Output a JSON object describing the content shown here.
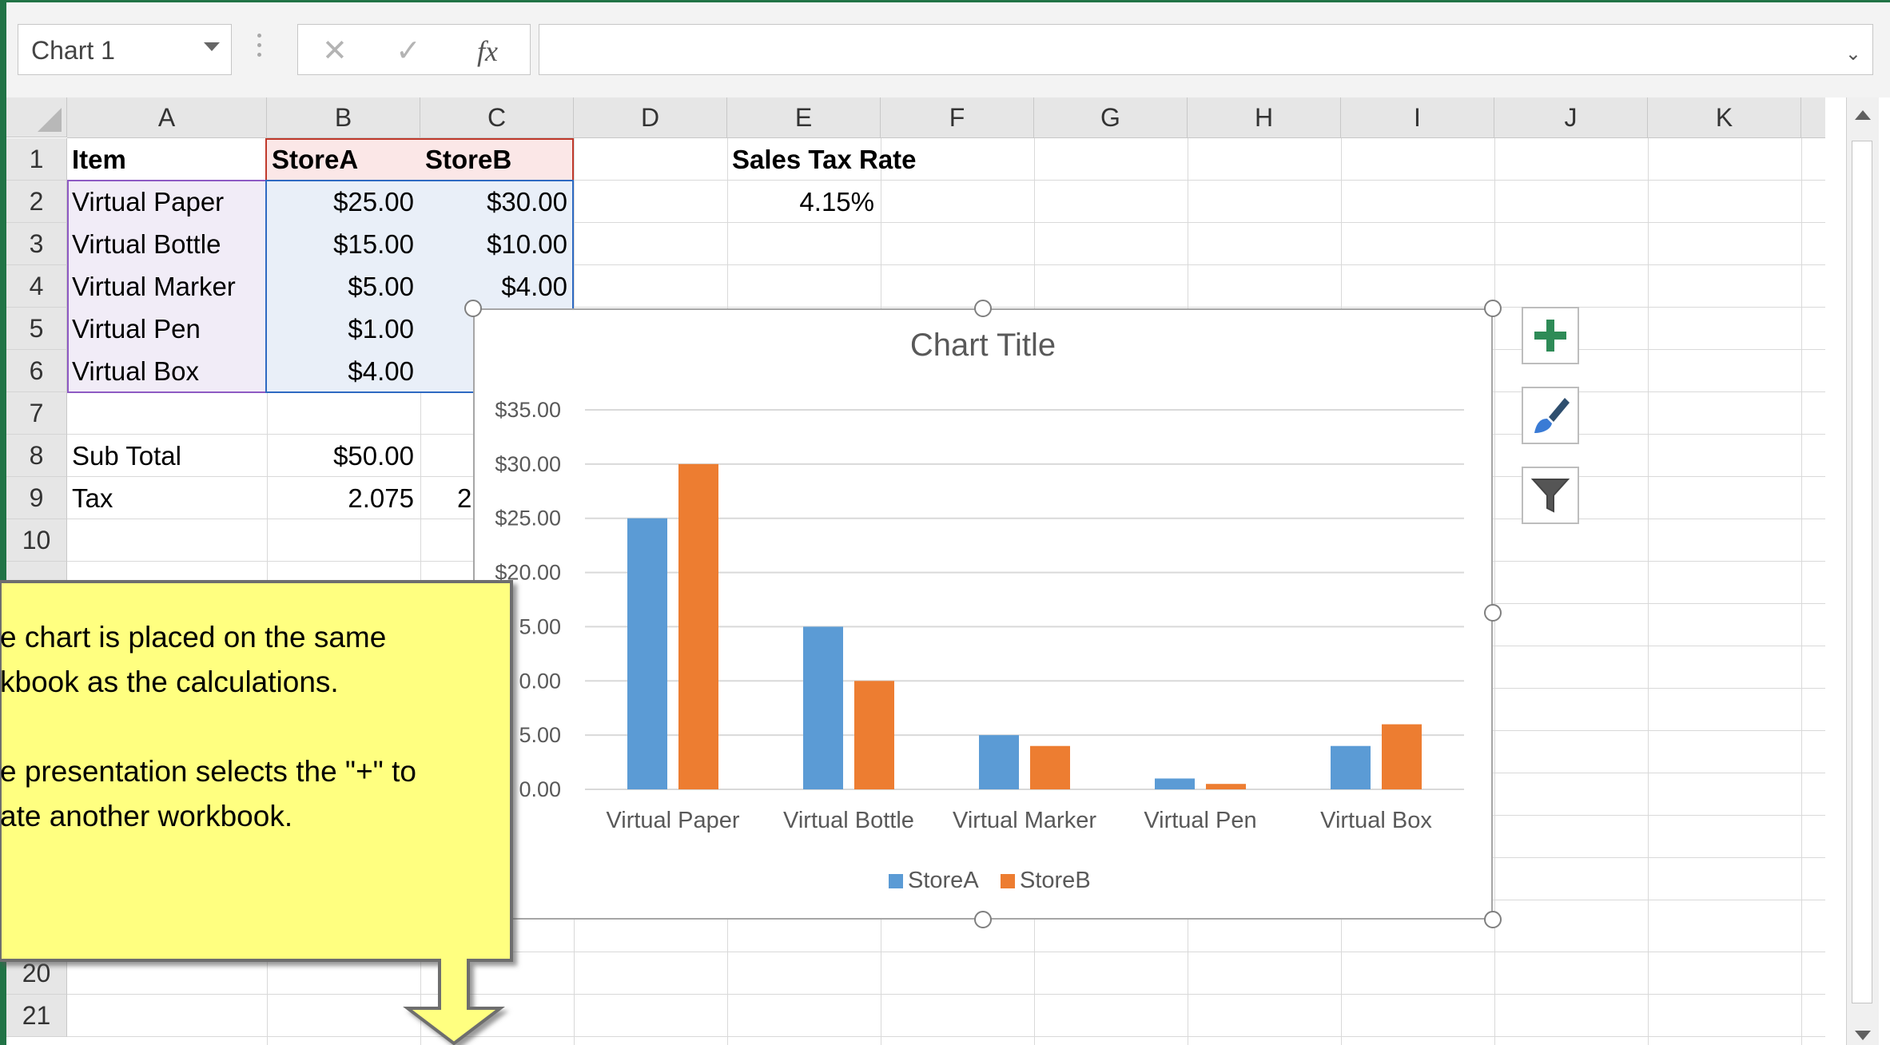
{
  "name_box": {
    "value": "Chart 1"
  },
  "formula_bar": {
    "cancel_icon": "close-icon",
    "enter_icon": "check-icon",
    "function_label": "fx",
    "value": ""
  },
  "columns": [
    "A",
    "B",
    "C",
    "D",
    "E",
    "F",
    "G",
    "H",
    "I",
    "J",
    "K"
  ],
  "rows": [
    "1",
    "2",
    "3",
    "4",
    "5",
    "6",
    "7",
    "8",
    "9",
    "10",
    "20",
    "21"
  ],
  "cells": {
    "A1": "Item",
    "B1": "StoreA",
    "C1": "StoreB",
    "E1": "Sales Tax Rate",
    "A2": "Virtual Paper",
    "B2": "$25.00",
    "C2": "$30.00",
    "E2": "4.15%",
    "A3": "Virtual Bottle",
    "B3": "$15.00",
    "C3": "$10.00",
    "A4": "Virtual Marker",
    "B4": "$5.00",
    "C4": "$4.00",
    "A5": "Virtual Pen",
    "B5": "$1.00",
    "A6": "Virtual Box",
    "B6": "$4.00",
    "A8": "Sub Total",
    "B8": "$50.00",
    "A9": "Tax",
    "B9": "2.075",
    "C9": "2"
  },
  "chart_side_buttons": [
    {
      "name": "chart-elements-button",
      "icon": "plus-icon"
    },
    {
      "name": "chart-styles-button",
      "icon": "brush-icon"
    },
    {
      "name": "chart-filters-button",
      "icon": "filter-icon"
    }
  ],
  "callout": {
    "line1": "e chart is placed on the same",
    "line2": "kbook as the calculations.",
    "line3": "e presentation selects the \"+\" to",
    "line4": "ate another workbook.",
    "background": "#ffff80",
    "arrow_color": "#ffff80"
  },
  "chart_data": {
    "type": "bar",
    "title": "Chart Title",
    "categories": [
      "Virtual Paper",
      "Virtual Bottle",
      "Virtual Marker",
      "Virtual Pen",
      "Virtual Box"
    ],
    "series": [
      {
        "name": "StoreA",
        "values": [
          25,
          15,
          5,
          1,
          4
        ],
        "color": "#5b9bd5"
      },
      {
        "name": "StoreB",
        "values": [
          30,
          10,
          4,
          0.5,
          6
        ],
        "color": "#ed7d31"
      }
    ],
    "y_ticks": [
      "$35.00",
      "$30.00",
      "$25.00",
      "$20.00",
      "5.00",
      "0.00",
      "5.00",
      "0.00"
    ],
    "ylim": [
      0,
      35
    ],
    "grid": true,
    "legend": "bottom"
  }
}
